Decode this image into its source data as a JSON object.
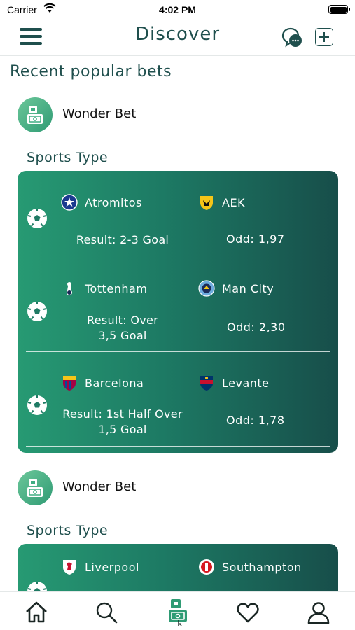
{
  "status": {
    "carrier": "Carrier",
    "time": "4:02 PM"
  },
  "nav": {
    "title": "Discover"
  },
  "section_heading": "Recent popular bets",
  "colors": {
    "primary": "#1f4f4d",
    "card_start": "#279a73",
    "card_end": "#174e4a",
    "avatar": "#3fae82"
  },
  "bets": [
    {
      "bettor": "Wonder Bet",
      "sports_type": "Sports Type",
      "matches": [
        {
          "home": "Atromitos",
          "home_icon": "atromitos-crest-icon",
          "away": "AEK",
          "away_icon": "aek-crest-icon",
          "result": [
            "Result: 2-3 Goal"
          ],
          "odd": "Odd: 1,97"
        },
        {
          "home": "Tottenham",
          "home_icon": "tottenham-crest-icon",
          "away": "Man City",
          "away_icon": "man-city-crest-icon",
          "result": [
            "Result: Over",
            "3,5 Goal"
          ],
          "odd": "Odd: 2,30"
        },
        {
          "home": "Barcelona",
          "home_icon": "barcelona-crest-icon",
          "away": "Levante",
          "away_icon": "levante-crest-icon",
          "result": [
            "Result: 1st Half Over",
            "1,5 Goal"
          ],
          "odd": "Odd: 1,78"
        }
      ]
    },
    {
      "bettor": "Wonder Bet",
      "sports_type": "Sports Type",
      "matches": [
        {
          "home": "Liverpool",
          "home_icon": "liverpool-crest-icon",
          "away": "Southampton",
          "away_icon": "southampton-crest-icon"
        }
      ]
    }
  ],
  "tabs": [
    "home-icon",
    "search-icon",
    "bet-slip-icon",
    "heart-icon",
    "profile-icon"
  ]
}
